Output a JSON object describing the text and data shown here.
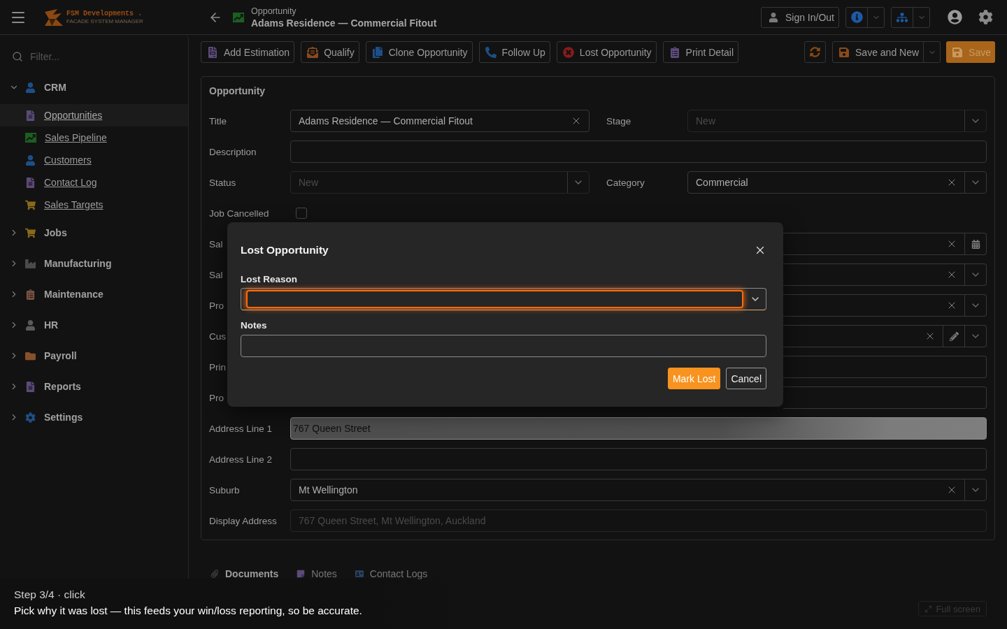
{
  "header": {
    "app_name": "FSM Developments .",
    "tagline": "FACADE SYSTEM MANAGER",
    "breadcrumb": "Opportunity",
    "title": "Adams Residence — Commercial Fitout",
    "sign_in": "Sign In/Out"
  },
  "sidebar": {
    "filter_placeholder": "Filter...",
    "groups": [
      {
        "label": "CRM",
        "expanded": true,
        "children": [
          {
            "label": "Opportunities",
            "selected": true
          },
          {
            "label": "Sales Pipeline",
            "selected": false
          },
          {
            "label": "Customers",
            "selected": false
          },
          {
            "label": "Contact Log",
            "selected": false
          },
          {
            "label": "Sales Targets",
            "selected": false
          }
        ]
      },
      {
        "label": "Jobs",
        "expanded": false
      },
      {
        "label": "Manufacturing",
        "expanded": false
      },
      {
        "label": "Maintenance",
        "expanded": false
      },
      {
        "label": "HR",
        "expanded": false
      },
      {
        "label": "Payroll",
        "expanded": false
      },
      {
        "label": "Reports",
        "expanded": false
      },
      {
        "label": "Settings",
        "expanded": false
      }
    ]
  },
  "toolbar": {
    "actions": [
      "Add Estimation",
      "Qualify",
      "Clone Opportunity",
      "Follow Up",
      "Lost Opportunity",
      "Print Detail"
    ],
    "save_and_new": "Save and New",
    "save": "Save"
  },
  "form": {
    "title": "Opportunity",
    "rows": [
      {
        "label": "Title",
        "field": {
          "kind": "text",
          "value": "Adams Residence — Commercial Fitout",
          "clearable": true,
          "disabled": false
        },
        "label_2": "Stage",
        "field_2": {
          "kind": "select",
          "value": "New",
          "clearable": false,
          "disabled": true
        }
      },
      {
        "label": "Description",
        "field": {
          "kind": "text",
          "clearable": false,
          "disabled": false
        }
      },
      {
        "label": "Status",
        "field": {
          "kind": "select",
          "value": "New",
          "clearable": false,
          "disabled": true
        },
        "label_2": "Category",
        "field_2": {
          "kind": "select",
          "value": "Commercial",
          "clearable": true,
          "disabled": false
        }
      },
      {
        "label": "Job Cancelled",
        "field": {
          "kind": "checkbox",
          "checked": false
        }
      },
      {
        "label": "Sal",
        "field_2": {
          "kind": "date",
          "clearable": true,
          "disabled": false
        }
      },
      {
        "label": "Sal",
        "field_2": {
          "kind": "select",
          "clearable": true,
          "disabled": false
        }
      },
      {
        "label": "Pro",
        "field_2": {
          "kind": "select",
          "clearable": true,
          "disabled": false
        }
      },
      {
        "label": "Cus",
        "field_2": {
          "kind": "lookup",
          "clearable": true,
          "disabled": false
        }
      },
      {
        "label": "Prin",
        "field_2": {
          "kind": "text",
          "clearable": false,
          "disabled": false
        }
      },
      {
        "label": "Pro",
        "field_2": {
          "kind": "text",
          "clearable": false,
          "disabled": false
        }
      },
      {
        "label": "Address Line 1",
        "field": {
          "kind": "text",
          "value": "767 Queen Street",
          "clearable": false,
          "disabled": false,
          "autofilled": true
        }
      },
      {
        "label": "Address Line 2",
        "field": {
          "kind": "text",
          "clearable": false,
          "disabled": false
        }
      },
      {
        "label": "Suburb",
        "field": {
          "kind": "select",
          "value": "Mt Wellington",
          "clearable": true,
          "disabled": false
        }
      },
      {
        "label": "Display Address",
        "field": {
          "kind": "text",
          "value": "767 Queen Street, Mt Wellington, Auckland",
          "clearable": false,
          "disabled": true
        }
      }
    ]
  },
  "tabs": [
    {
      "label": "Documents",
      "selected": true
    },
    {
      "label": "Notes",
      "selected": false
    },
    {
      "label": "Contact Logs",
      "selected": false
    }
  ],
  "full_screen": "Full screen",
  "dialog": {
    "title": "Lost Opportunity",
    "fields": [
      {
        "label": "Lost Reason",
        "kind": "select",
        "focused": true
      },
      {
        "label": "Notes",
        "kind": "text",
        "focused": false
      }
    ],
    "buttons": [
      {
        "label": "Mark Lost",
        "kind": "primary"
      },
      {
        "label": "Cancel",
        "kind": "secondary"
      }
    ]
  },
  "tour": {
    "step": "Step 3/4 · click",
    "message": "Pick why it was lost — this feeds your win/loss reporting, so be accurate."
  }
}
